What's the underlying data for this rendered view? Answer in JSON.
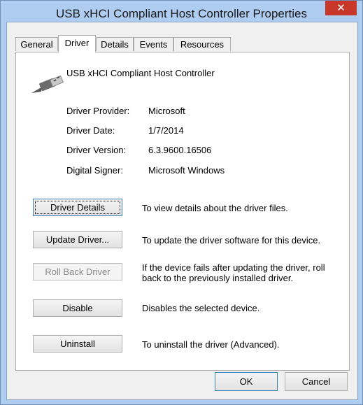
{
  "window": {
    "title": "USB xHCI Compliant Host Controller Properties",
    "close_glyph": "✕"
  },
  "tabs": [
    {
      "label": "General"
    },
    {
      "label": "Driver",
      "active": true
    },
    {
      "label": "Details"
    },
    {
      "label": "Events"
    },
    {
      "label": "Resources"
    }
  ],
  "device": {
    "name": "USB xHCI Compliant Host Controller",
    "icon": "usb-connector-icon"
  },
  "info": {
    "provider_label": "Driver Provider:",
    "provider_value": "Microsoft",
    "date_label": "Driver Date:",
    "date_value": "1/7/2014",
    "version_label": "Driver Version:",
    "version_value": "6.3.9600.16506",
    "signer_label": "Digital Signer:",
    "signer_value": "Microsoft Windows"
  },
  "actions": {
    "details_label": "Driver Details",
    "details_desc": "To view details about the driver files.",
    "update_label": "Update Driver...",
    "update_desc": "To update the driver software for this device.",
    "rollback_label": "Roll Back Driver",
    "rollback_desc": "If the device fails after updating the driver, roll back to the previously installed driver.",
    "disable_label": "Disable",
    "disable_desc": "Disables the selected device.",
    "uninstall_label": "Uninstall",
    "uninstall_desc": "To uninstall the driver (Advanced)."
  },
  "footer": {
    "ok_label": "OK",
    "cancel_label": "Cancel"
  }
}
